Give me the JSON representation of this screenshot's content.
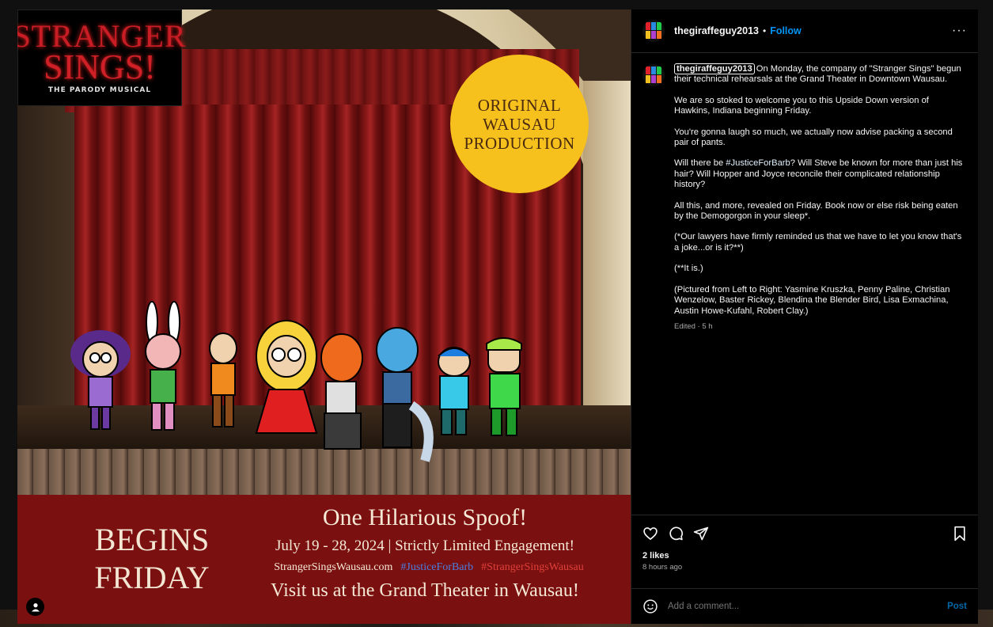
{
  "poster": {
    "logo_line1": "STRANGER",
    "logo_line2": "SINGS!",
    "logo_tag": "THE PARODY MUSICAL",
    "badge": [
      "ORIGINAL",
      "WAUSAU",
      "PRODUCTION"
    ],
    "begins": "BEGINS",
    "friday": "FRIDAY",
    "headline": "One Hilarious Spoof!",
    "dates": "July 19 - 28, 2024 | Strictly Limited Engagement!",
    "site": "StrangerSingsWausau.com",
    "tag1": "#JusticeForBarb",
    "tag2": "#StrangerSingsWausau",
    "visit": "Visit us at the Grand Theater in Wausau!"
  },
  "header": {
    "username": "thegiraffeguy2013",
    "separator": "•",
    "follow_label": "Follow",
    "more_label": "···"
  },
  "caption": {
    "username": "thegiraffeguy2013",
    "p1": "On Monday, the company of \"Stranger Sings\" begun their technical rehearsals at the Grand Theater in Downtown Wausau.",
    "p2": "We are so stoked to welcome you to this Upside Down version of Hawkins, Indiana beginning Friday.",
    "p3": "You're gonna laugh so much, we actually now advise packing a second pair of pants.",
    "p4_hashtag": "#JusticeForBarb",
    "p4_prefix": "Will there be ",
    "p4_rest": "? Will Steve be known for more than just his hair? Will Hopper and Joyce reconcile their complicated relationship history?",
    "p5": "All this, and more, revealed on Friday. Book now or else risk being eaten by the Demogorgon in your sleep*.",
    "p6": "(*Our lawyers have firmly reminded us that we have to let you know that's a joke...or is it?**)",
    "p7": "(**It is.)",
    "p8": "(Pictured from Left to Right: Yasmine Kruszka, Penny Paline, Christian Wenzelow, Baster Rickey, Blendina the Blender Bird, Lisa Exmachina, Austin Howe-Kufahl, Robert Clay.)",
    "edited": "Edited · 5 h"
  },
  "engagement": {
    "likes": "2 likes",
    "posted": "8 hours ago"
  },
  "comment": {
    "placeholder": "Add a comment...",
    "post_label": "Post"
  },
  "colors": {
    "accent": "#0095f6",
    "banner": "#7a1010",
    "badge": "#f6c11c"
  }
}
